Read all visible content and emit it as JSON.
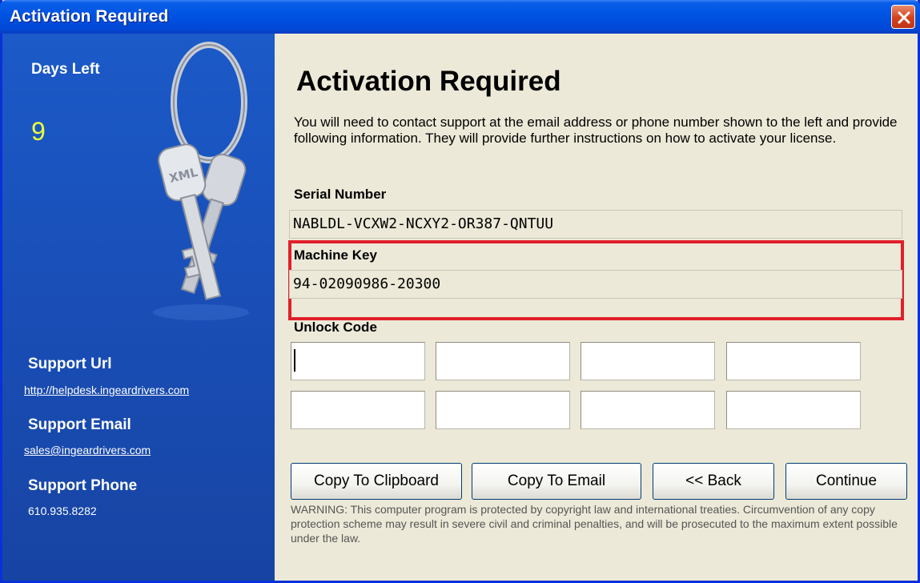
{
  "window": {
    "title": "Activation Required"
  },
  "sidebar": {
    "days_left_label": "Days Left",
    "days_left_value": "9",
    "support_url_label": "Support Url",
    "support_url": "http://helpdesk.ingeardrivers.com",
    "support_email_label": "Support Email",
    "support_email": "sales@ingeardrivers.com",
    "support_phone_label": "Support Phone",
    "support_phone": "610.935.8282",
    "image_icon": "keys-icon",
    "key_tag_text": "XML"
  },
  "main": {
    "heading": "Activation Required",
    "instructions": "You will need to contact support at the email address or phone number shown to the left and provide following information. They will provide further instructions on how to activate your license.",
    "serial_label": "Serial Number",
    "serial_value": "NABLDL-VCXW2-NCXY2-OR387-QNTUU",
    "machine_key_label": "Machine Key",
    "machine_key_value": "94-02090986-20300",
    "unlock_code_label": "Unlock Code",
    "unlock_code_fields": [
      "",
      "",
      "",
      "",
      "",
      "",
      "",
      ""
    ],
    "highlight_color": "#e0202a"
  },
  "buttons": {
    "copy_clipboard": "Copy To Clipboard",
    "copy_email": "Copy To Email",
    "back": "<< Back",
    "continue": "Continue"
  },
  "warning": "WARNING: This computer program is protected by copyright law and international treaties. Circumvention of any copy protection scheme may result in severe civil and criminal penalties, and will be prosecuted to the maximum extent possible under the law.",
  "colors": {
    "titlebar": "#0054e3",
    "sidebar": "#1a4fb8",
    "days_value": "#e9ff3c",
    "dialog_bg": "#ece9d8"
  }
}
